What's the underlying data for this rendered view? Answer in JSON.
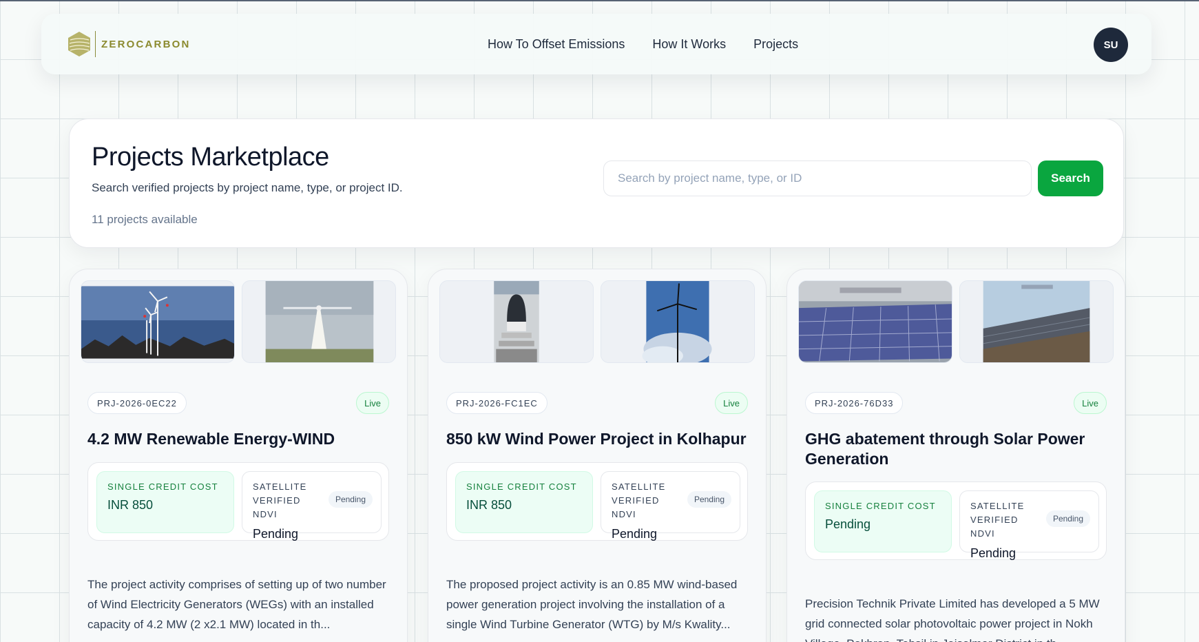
{
  "brand": {
    "name": "ZEROCARBON"
  },
  "nav": {
    "links": [
      "How To Offset Emissions",
      "How It Works",
      "Projects"
    ],
    "avatar_initials": "SU"
  },
  "hero": {
    "title": "Projects Marketplace",
    "subtitle": "Search verified projects by project name, type, or project ID.",
    "count": "11 projects available",
    "search_placeholder": "Search by project name, type, or ID",
    "search_value": "",
    "search_button": "Search"
  },
  "projects": [
    {
      "id": "PRJ-2026-0EC22",
      "status": "Live",
      "title": "4.2 MW Renewable Energy-WIND",
      "cost_label": "SINGLE CREDIT COST",
      "cost_value": "INR 850",
      "ndvi_label": "SATELLITE VERIFIED NDVI",
      "ndvi_pill": "Pending",
      "ndvi_value": "Pending",
      "description": "The project activity comprises of setting up of two number of Wind Electricity Generators (WEGs) with an installed capacity of 4.2 MW (2 x2.1 MW) located in th..."
    },
    {
      "id": "PRJ-2026-FC1EC",
      "status": "Live",
      "title": "850 kW Wind Power Project in Kolhapur",
      "cost_label": "SINGLE CREDIT COST",
      "cost_value": "INR 850",
      "ndvi_label": "SATELLITE VERIFIED NDVI",
      "ndvi_pill": "Pending",
      "ndvi_value": "Pending",
      "description": "The proposed project activity is an 0.85 MW wind-based power generation project involving the installation of a single Wind Turbine Generator (WTG) by M/s Kwality..."
    },
    {
      "id": "PRJ-2026-76D33",
      "status": "Live",
      "title": "GHG abatement through Solar Power Generation",
      "cost_label": "SINGLE CREDIT COST",
      "cost_value": "Pending",
      "ndvi_label": "SATELLITE VERIFIED NDVI",
      "ndvi_pill": "Pending",
      "ndvi_value": "Pending",
      "description": "Precision Technik Private Limited has developed a 5 MW grid connected solar photovoltaic power project in Nokh Village, Pokhran, Tehsil in Jaisalmer District in th..."
    }
  ],
  "colors": {
    "accent_green": "#0aa63f",
    "brand_olive": "#8b8a2e",
    "avatar_bg": "#1e293b"
  }
}
